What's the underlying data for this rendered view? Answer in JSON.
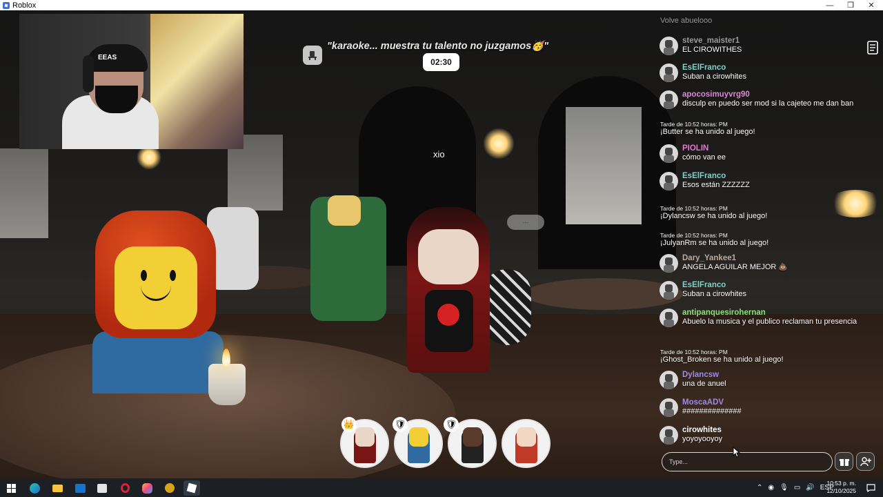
{
  "window": {
    "title": "Roblox",
    "minimize_glyph": "—",
    "maximize_glyph": "❐",
    "close_glyph": "✕"
  },
  "game": {
    "server_title": "\"karaoke... muestra tu talento no juzgamos🥳\"",
    "timer": "02:30",
    "nametag": "xio",
    "stage_icon": "chair-icon",
    "notes_icon": "notes-icon"
  },
  "seats": [
    {
      "badge": "👑",
      "badge_icon": "crown-icon",
      "color": "#7a1515",
      "head": "#e9d6c6"
    },
    {
      "badge": "🛡",
      "badge_icon": "shield-icon",
      "color": "#2f6aa0",
      "head": "#f3cf36"
    },
    {
      "badge": "🛡",
      "badge_icon": "shield-icon",
      "color": "#222222",
      "head": "#5a3a2a"
    },
    {
      "badge": "",
      "badge_icon": "",
      "color": "#c03a25",
      "head": "#f2d7c5"
    }
  ],
  "chat": {
    "partial_top": "Volve abuelooo",
    "messages": [
      {
        "kind": "user",
        "user": "steve_maister1",
        "color": "#9a9a9a",
        "text": "EL CIROWITHES"
      },
      {
        "kind": "user",
        "user": "EsElFranco",
        "color": "#7fd1c8",
        "text": "Suban a cirowhites"
      },
      {
        "kind": "user",
        "user": "apocosimuyvrg90",
        "color": "#d58ad0",
        "text": "disculp en puedo ser mod si la cajeteo me dan ban"
      },
      {
        "kind": "system",
        "time": "Tarde de 10:52 horas: PM",
        "text": "¡Butter se ha unido al juego!"
      },
      {
        "kind": "user",
        "user": "PIOLIN",
        "color": "#e27ad3",
        "text": "cómo van ee"
      },
      {
        "kind": "user",
        "user": "EsElFranco",
        "color": "#7fd1c8",
        "text": "Esos están ZZZZZZ"
      },
      {
        "kind": "system",
        "time": "Tarde de 10:52 horas: PM",
        "text": "¡Dylancsw se ha unido al juego!"
      },
      {
        "kind": "system",
        "time": "Tarde de 10:52 horas: PM",
        "text": "¡JulyanRm se ha unido al juego!"
      },
      {
        "kind": "user",
        "user": "Dary_Yankee1",
        "color": "#b9a9a0",
        "text": "ANGELA AGUILAR MEJOR 💩"
      },
      {
        "kind": "user",
        "user": "EsElFranco",
        "color": "#7fd1c8",
        "text": "Suban a cirowhites"
      },
      {
        "kind": "user",
        "user": "antipanquesirohernan",
        "color": "#8fe07a",
        "text": "Abuelo la musica y el publico reclaman tu presencia"
      },
      {
        "kind": "system",
        "time": "Tarde de 10:52 horas: PM",
        "text": "¡Ghost_Broken se ha unido al juego!"
      },
      {
        "kind": "user",
        "user": "Dylancsw",
        "color": "#a08ae0",
        "text": "una de anuel"
      },
      {
        "kind": "user",
        "user": "MoscaADV",
        "color": "#a08ae0",
        "text": "##############"
      },
      {
        "kind": "user",
        "user": "cirowhites",
        "color": "#ffffff",
        "text": "yoyoyooyoy"
      }
    ],
    "input_placeholder": "Type...",
    "gift_icon": "gift-icon",
    "add_friend_icon": "add-friend-icon"
  },
  "taskbar": {
    "language": "ESP",
    "time": "10:53 p. m.",
    "date": "12/10/2025",
    "apps": [
      "windows-icon",
      "edge-icon",
      "file-explorer-icon",
      "outlook-icon",
      "store-icon",
      "opera-icon",
      "copilot-icon",
      "game-icon",
      "roblox-icon"
    ]
  }
}
